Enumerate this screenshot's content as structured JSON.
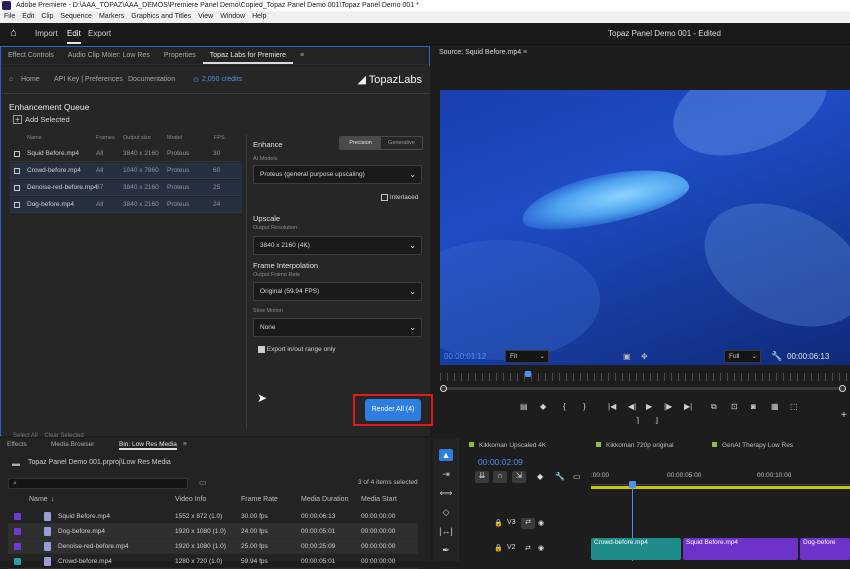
{
  "window": {
    "title": "Adobe Premiere - D:\\AAA_TOPAZ\\AAA_DEMOS\\Premiere Panel Demo\\Copied_Topaz Panel Demo 001\\Topaz Panel Demo 001 *"
  },
  "menu": [
    "File",
    "Edit",
    "Clip",
    "Sequence",
    "Markers",
    "Graphics and Titles",
    "View",
    "Window",
    "Help"
  ],
  "header": {
    "nav": [
      "Import",
      "Edit",
      "Export"
    ],
    "project_title": "Topaz Panel Demo 001 - Edited"
  },
  "left_tabs": [
    "Effect Controls",
    "Audio Clip Mixer: Low Res",
    "Properties",
    "Topaz Labs for Premiere"
  ],
  "plugin": {
    "links": [
      "Home",
      "API Key | Preferences",
      "Documentation"
    ],
    "credits": "2,050 credits",
    "brand": "TopazLabs",
    "queue_title": "Enhancement Queue",
    "add_selected": "Add Selected",
    "columns": [
      "Name",
      "Frames",
      "Output size",
      "Model",
      "FPS"
    ],
    "rows": [
      {
        "name": "Squid Before.mp4",
        "frames": "All",
        "size": "3840 x 2160",
        "model": "Proteus",
        "fps": "30"
      },
      {
        "name": "Crowd-before.mp4",
        "frames": "All",
        "size": "1040 x 7860",
        "model": "Proteus",
        "fps": "60"
      },
      {
        "name": "Denoise-red-before.mp4",
        "frames": "67",
        "size": "3840 x 2160",
        "model": "Proteus",
        "fps": "25"
      },
      {
        "name": "Dog-before.mp4",
        "frames": "All",
        "size": "3840 x 2160",
        "model": "Proteus",
        "fps": "24"
      }
    ],
    "bottom_links": [
      "Select All",
      "Clear Selected"
    ],
    "enhance_label": "Enhance",
    "mode_options": [
      "Precision",
      "Generative"
    ],
    "ai_models_label": "AI Models",
    "ai_model_value": "Proteus (general purpose upscaling)",
    "interlaced_label": "Interlaced",
    "upscale_label": "Upscale",
    "output_resolution_label": "Output Resolution",
    "output_resolution_value": "3840 x 2160 (4K)",
    "frame_interp_label": "Frame Interpolation",
    "output_frame_rate_label": "Output Frame Rate",
    "output_frame_rate_value": "Original (59.94 FPS)",
    "slow_motion_label": "Slow Motion",
    "slow_motion_value": "None",
    "export_range_label": "Export in/out range only",
    "render_button": "Render All (4)"
  },
  "source": {
    "tab": "Source: Squid Before.mp4",
    "timecode_in": "00:00:01:12",
    "fit_value": "Fit",
    "quality_value": "Full",
    "timecode_out": "00:00:06:13"
  },
  "project": {
    "tabs": [
      "Effects",
      "Media Browser",
      "Bin: Low Res Media"
    ],
    "path": "Topaz Panel Demo 001.prproj\\Low Res Media",
    "items_selected": "3 of 4 items selected",
    "columns": [
      "Name",
      "Video Info",
      "Frame Rate",
      "Media Duration",
      "Media Start"
    ],
    "rows": [
      {
        "name": "Squid Before.mp4",
        "info": "1552 x 872 (1.0)",
        "fps": "30.00 fps",
        "duration": "00:00:06:13",
        "start": "00:00:00:00"
      },
      {
        "name": "Dog-before.mp4",
        "info": "1920 x 1080 (1.0)",
        "fps": "24.00 fps",
        "duration": "00:00:05:01",
        "start": "00:00:00:00"
      },
      {
        "name": "Denoise-red-before.mp4",
        "info": "1920 x 1080 (1.0)",
        "fps": "25.00 fps",
        "duration": "00:00:25:09",
        "start": "00:00:00:00"
      },
      {
        "name": "Crowd-before.mp4",
        "info": "1280 x 720 (1.0)",
        "fps": "59.94 fps",
        "duration": "00:00:05:01",
        "start": "00:00:00:00"
      }
    ]
  },
  "timeline": {
    "sequences": [
      "Kikkoman Upscaled 4K",
      "Kikkoman 720p original",
      "GenAI Therapy Low Res"
    ],
    "timecode": "00:00:02:09",
    "ruler": [
      ":00:00",
      "00:00:05:00",
      "00:00:10:00"
    ],
    "tracks": [
      "V3",
      "V2"
    ],
    "clips": [
      "Crowd-before.mp4",
      "Squid Before.mp4",
      "Dog-before"
    ]
  },
  "colors": {
    "accent": "#2e7de0",
    "highlight_box": "#e01b1b",
    "timecode": "#4e8ff0",
    "label_purple": "#6e3ad6"
  }
}
